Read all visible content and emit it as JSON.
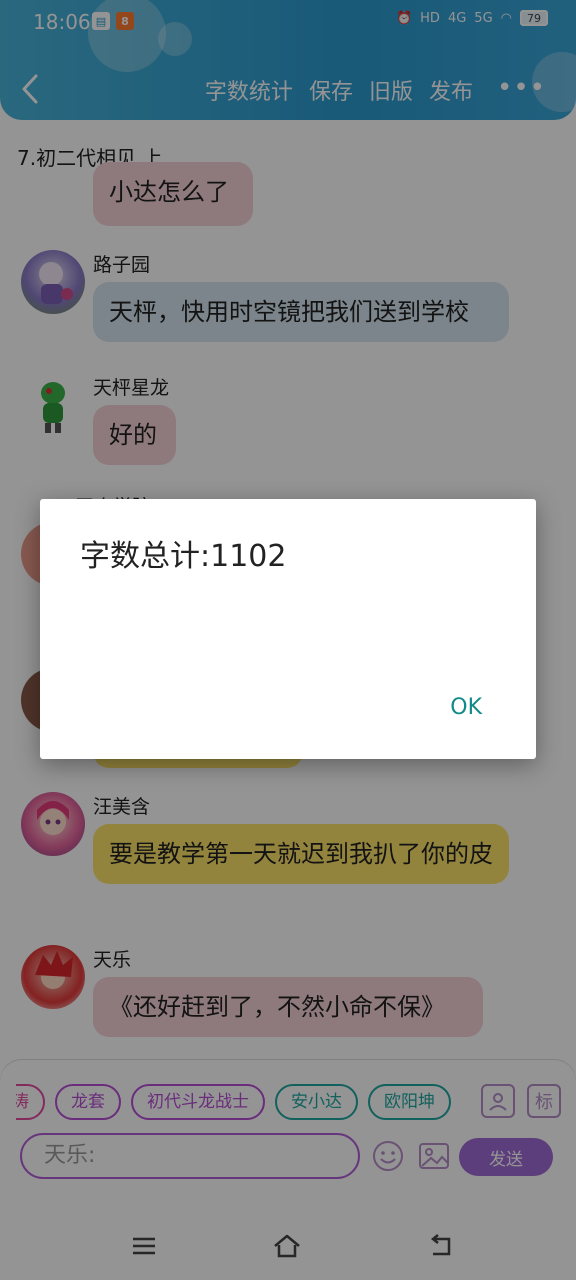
{
  "status_bar": {
    "time": "18:06",
    "battery": "79",
    "network_labels": [
      "HD",
      "4G",
      "5G"
    ]
  },
  "header": {
    "actions": [
      "字数统计",
      "保存",
      "旧版",
      "发布"
    ],
    "more": "•••"
  },
  "chat": {
    "title": "7.初二代相见 上",
    "messages": [
      {
        "sender": "",
        "text": "小达怎么了"
      },
      {
        "sender": "路子园",
        "text": "天枰，快用时空镜把我们送到学校"
      },
      {
        "sender": "天枰星龙",
        "text": "好的"
      },
      {
        "sender": "汪美含",
        "text": "要是教学第一天就迟到我扒了你的皮"
      },
      {
        "sender": "天乐",
        "text": "《还好赶到了，不然小命不保》"
      }
    ],
    "partial_sender": "王小学院"
  },
  "input_panel": {
    "chips": [
      "涛",
      "龙套",
      "初代斗龙战士",
      "安小达",
      "欧阳坤"
    ],
    "tool_label": "标",
    "input_placeholder": "天乐:",
    "send_label": "发送"
  },
  "dialog": {
    "message": "字数总计:1102",
    "ok_label": "OK"
  },
  "colors": {
    "header": "#2b9bd0",
    "accent": "#a06bd8",
    "ok": "#138a8a"
  }
}
